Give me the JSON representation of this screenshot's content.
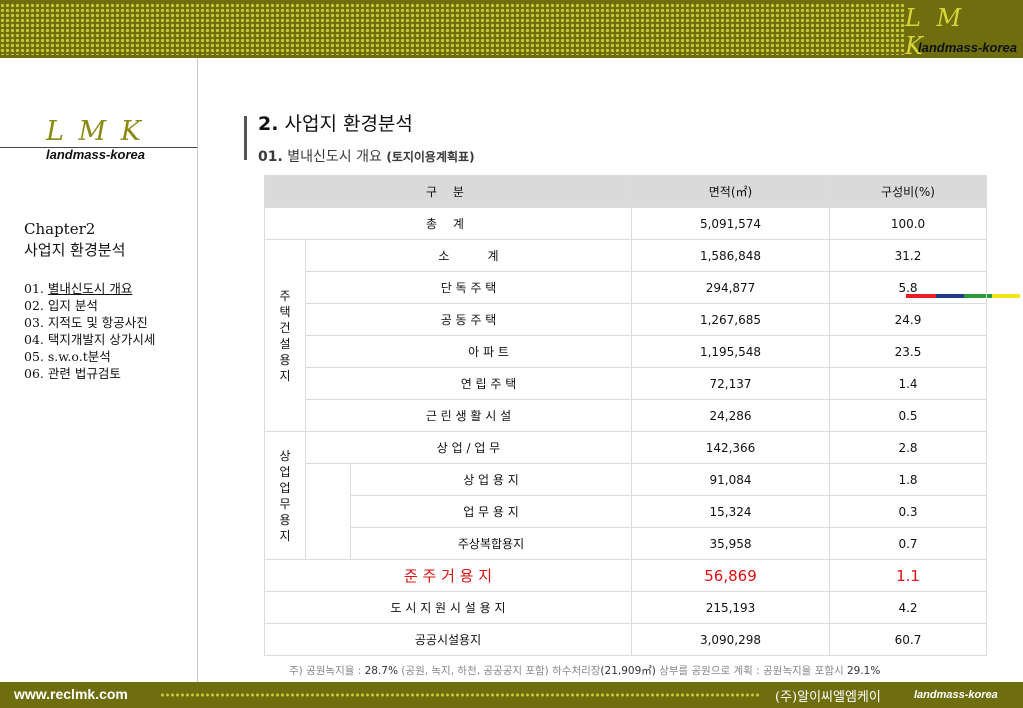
{
  "header": {
    "logo": "L M K",
    "brand": "landmass-korea"
  },
  "sidebar": {
    "logo": "L M K",
    "brand": "landmass-korea",
    "chapter": "Chapter2",
    "chapter_title": "사업지 환경분석",
    "items": [
      {
        "num": "01. ",
        "label": "별내신도시 개요"
      },
      {
        "num": "02. ",
        "label": "입지 분석"
      },
      {
        "num": "03. ",
        "label": "지적도 및 항공사진"
      },
      {
        "num": "04. ",
        "label": "택지개발지 상가시세"
      },
      {
        "num": "05. ",
        "label": "s.w.o.t분석"
      },
      {
        "num": "06. ",
        "label": "관련 법규검토"
      }
    ]
  },
  "title": {
    "num": "2.",
    "text": " 사업지 환경분석",
    "sub_num": "01.",
    "sub_text": " 별내신도시 개요 ",
    "sub_paren": "(토지이용계획표)"
  },
  "stripe_colors": [
    "#e31e24",
    "#1f3a8f",
    "#2a9b3b",
    "#f6e31c"
  ],
  "table": {
    "headers": [
      "구 분",
      "면적(㎡)",
      "구성비(%)"
    ],
    "group1": "주\n택\n건\n설\n용\n지",
    "group2": "상\n업\n업\n무\n용\n지",
    "rows": [
      {
        "label": "총 계",
        "area": "5,091,574",
        "ratio": "100.0"
      },
      {
        "label": "소          계",
        "area": "1,586,848",
        "ratio": "31.2"
      },
      {
        "label": "단 독 주 택",
        "area": "294,877",
        "ratio": "5.8"
      },
      {
        "label": "공 동 주 택",
        "area": "1,267,685",
        "ratio": "24.9"
      },
      {
        "label": "아 파 트",
        "area": "1,195,548",
        "ratio": "23.5"
      },
      {
        "label": "연 립 주 택",
        "area": "72,137",
        "ratio": "1.4"
      },
      {
        "label": "근 린 생 활 시 설",
        "area": "24,286",
        "ratio": "0.5"
      },
      {
        "label": "상 업 / 업 무",
        "area": "142,366",
        "ratio": "2.8"
      },
      {
        "label": "상 업 용 지",
        "area": "91,084",
        "ratio": "1.8"
      },
      {
        "label": "업 무 용 지",
        "area": "15,324",
        "ratio": "0.3"
      },
      {
        "label": "주상복합용지",
        "area": "35,958",
        "ratio": "0.7"
      },
      {
        "label": "준 주 거 용 지",
        "area": "56,869",
        "ratio": "1.1"
      },
      {
        "label": "도 시 지 원 시 설 용 지",
        "area": "215,193",
        "ratio": "4.2"
      },
      {
        "label": "공공시설용지",
        "area": "3,090,298",
        "ratio": "60.7"
      }
    ]
  },
  "note": {
    "p1": "주) 공원녹지율 : ",
    "v1": "28.7%",
    "p2": " (공원, 녹지, 하천, 공공공지 포함)   하수처리장",
    "v2": "(21,909㎡)",
    "p3": " 상부를 공원으로 계획 : 공원녹지율 포함시 ",
    "v3": "29.1%"
  },
  "footer": {
    "url": "www.reclmk.com",
    "company": "(주)알이씨엘엠케이",
    "brand": "landmass-korea"
  }
}
